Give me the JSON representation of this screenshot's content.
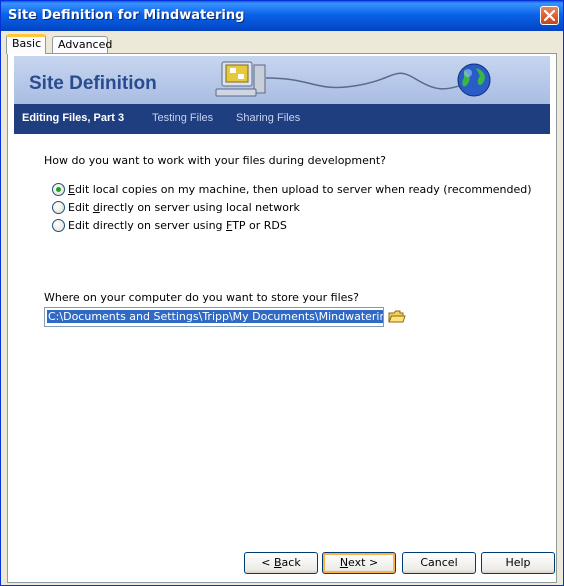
{
  "window": {
    "title": "Site Definition for Mindwatering"
  },
  "tabs": [
    {
      "label": "Basic"
    },
    {
      "label": "Advanced"
    }
  ],
  "banner": {
    "title": "Site Definition"
  },
  "steps": [
    {
      "label": "Editing Files, Part 3"
    },
    {
      "label": "Testing Files"
    },
    {
      "label": "Sharing Files"
    }
  ],
  "question": "How do you want to work with your files during development?",
  "options": [
    {
      "underline": "E",
      "rest": "dit local copies on my machine, then upload to server when ready (recommended)",
      "selected": true
    },
    {
      "pre": "Edit ",
      "underline": "d",
      "rest": "irectly on server using local network",
      "selected": false
    },
    {
      "pre": "Edit directly on server using ",
      "underline": "F",
      "rest": "TP or RDS",
      "selected": false
    }
  ],
  "storage": {
    "label": "Where on your computer do you want to store your files?",
    "value": "C:\\Documents and Settings\\Tripp\\My Documents\\Mindwatering\\"
  },
  "buttons": {
    "back": {
      "pre": "< ",
      "underline": "B",
      "rest": "ack"
    },
    "next": {
      "underline": "N",
      "rest": "ext >"
    },
    "cancel": "Cancel",
    "help": "Help"
  },
  "colors": {
    "title_bar": "#0a5fdc",
    "step_bar": "#1f3e80",
    "banner": "#c7d6ef",
    "selection": "#316ac5"
  }
}
